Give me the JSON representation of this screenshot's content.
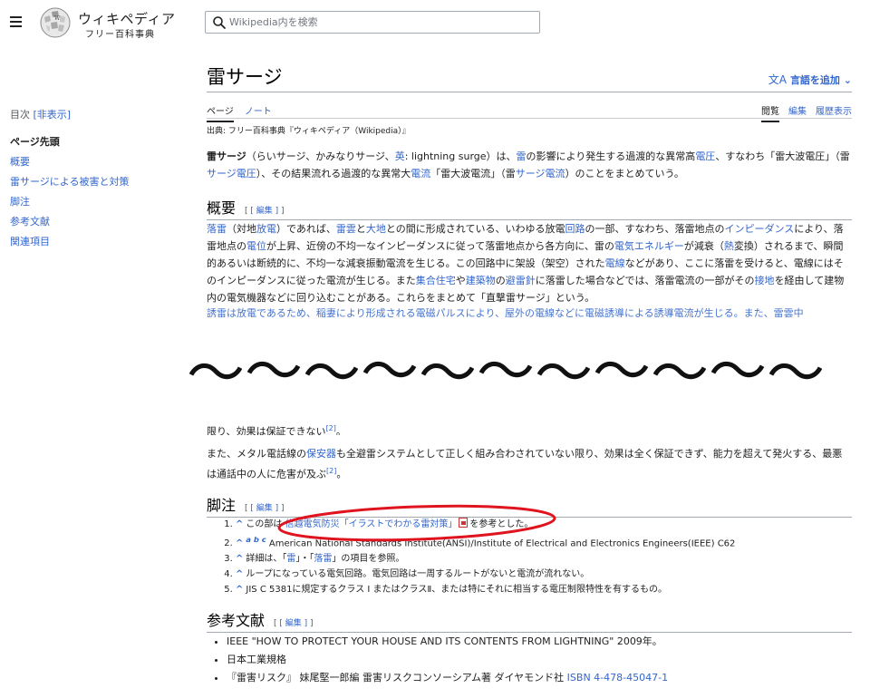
{
  "header": {
    "wordmark": "ウィキペディア",
    "tagline": "フリー百科事典",
    "search_placeholder": "Wikipedia内を検索"
  },
  "toc": {
    "heading": "目次",
    "toggle": "[非表示]",
    "items": [
      "ページ先頭",
      "概要",
      "雷サージによる被害と対策",
      "脚注",
      "参考文献",
      "関連項目"
    ]
  },
  "article": {
    "title": "雷サージ",
    "add_languages": "言語を追加",
    "tabs_left": [
      "ページ",
      "ノート"
    ],
    "tabs_right": [
      "閲覧",
      "編集",
      "履歴表示"
    ],
    "source": "出典: フリー百科事典『ウィキペディア（Wikipedia）』",
    "intro": {
      "bold": "雷サージ",
      "t1": "（らいサージ、かみなりサージ、",
      "l1": "英",
      "t2": ": lightning surge）は、",
      "l2": "雷",
      "t3": "の影響により発生する過渡的な異常高",
      "l3": "電圧",
      "t4": "、すなわち「雷大波電圧」（雷",
      "l4": "サージ電圧",
      "t5": "）、その結果流れる過渡的な異常大",
      "l5": "電流",
      "t6": "「雷大波電流」（雷",
      "l6": "サージ電流",
      "t7": "）のことをまとめていう。"
    },
    "edit_label": "[ 編集 ]",
    "overview": {
      "heading": "概要",
      "l1": "落雷",
      "t1": "（対地",
      "l2": "放電",
      "t2": "）であれば、",
      "l3": "雷雲",
      "t3": "と",
      "l4": "大地",
      "t4": "との間に形成されている、いわゆる放電",
      "l5": "回路",
      "t5": "の一部、すなわち、落雷地点の",
      "l6": "インピーダンス",
      "t6": "により、落雷地点の",
      "l7": "電位",
      "t7": "が上昇、近傍の不均一なインピーダンスに従って落雷地点から各方向に、雷の",
      "l8": "電気エネルギー",
      "t8": "が減衰（",
      "l9": "熱",
      "t9": "変換）されるまで、瞬間的あるいは断続的に、不均一な減衰振動電流を生じる。この回路中に架設（架空）された",
      "l10": "電線",
      "t10": "などがあり、ここに落雷を受けると、電線にはそのインピーダンスに従った電流が生じる。また",
      "l11": "集合住宅",
      "t11": "や",
      "l12": "建築物",
      "t12": "の",
      "l13": "避雷針",
      "t13": "に落雷した場合などでは、落雷電流の一部がその",
      "l14": "接地",
      "t14": "を経由して建物内の電気機器などに回り込むことがある。これらをまとめて「直撃雷サージ」という。"
    },
    "cut_line": "誘雷は放電であるため、稲妻により形成される電磁パルスにより、屋外の電線などに電磁誘導による誘導電流が生じる。また、雷雲中",
    "partial_top": {
      "text": "限り、効果は保証できない",
      "sup": "[2]",
      "end": "。"
    },
    "later_para": {
      "t1": "また、メタル電話線の",
      "l1": "保安器",
      "t2": "も全避雷システムとして正しく組み合わされていない限り、効果は全く保証できず、能力を超えて発火する、最悪は通話中の人に危害が及ぶ",
      "sup": "[2]",
      "end": "。"
    },
    "notes": {
      "heading": "脚注",
      "n1_pre": "この部は",
      "n1_link": "信越電気防災「イラストでわかる雷対策」",
      "n1_post": "を参考とした。",
      "n2_abc": "a b c",
      "n2_text": "American National Standards Institute(ANSI)/Institute of Electrical and Electronics Engineers(IEEE) C62",
      "n3_pre": "詳細は、「",
      "n3_l1": "雷",
      "n3_mid": "」・「",
      "n3_l2": "落雷",
      "n3_post": "」の項目を参照。",
      "n4": "ループになっている電気回路。電気回路は一周するルートがないと電流が流れない。",
      "n5": "JIS C 5381に規定するクラス I またはクラスⅡ、または特にそれに相当する電圧制限特性を有するもの。"
    },
    "references": {
      "heading": "参考文献",
      "r1": "IEEE \"HOW TO PROTECT YOUR HOUSE AND ITS CONTENTS FROM LIGHTNING\" 2009年。",
      "r2": "日本工業規格",
      "r3_text": "『雷害リスク』 妹尾堅一郎編 雷害リスクコンソーシアム著 ダイヤモンド社 ",
      "r3_link": "ISBN 4-478-45047-1"
    }
  },
  "annotation": {
    "wave_text": "～～～～～～～～～～～",
    "ellipse_color": "#e0141e"
  },
  "colors": {
    "link": "#3366cc",
    "text": "#202122",
    "rule": "#a2a9b1"
  }
}
